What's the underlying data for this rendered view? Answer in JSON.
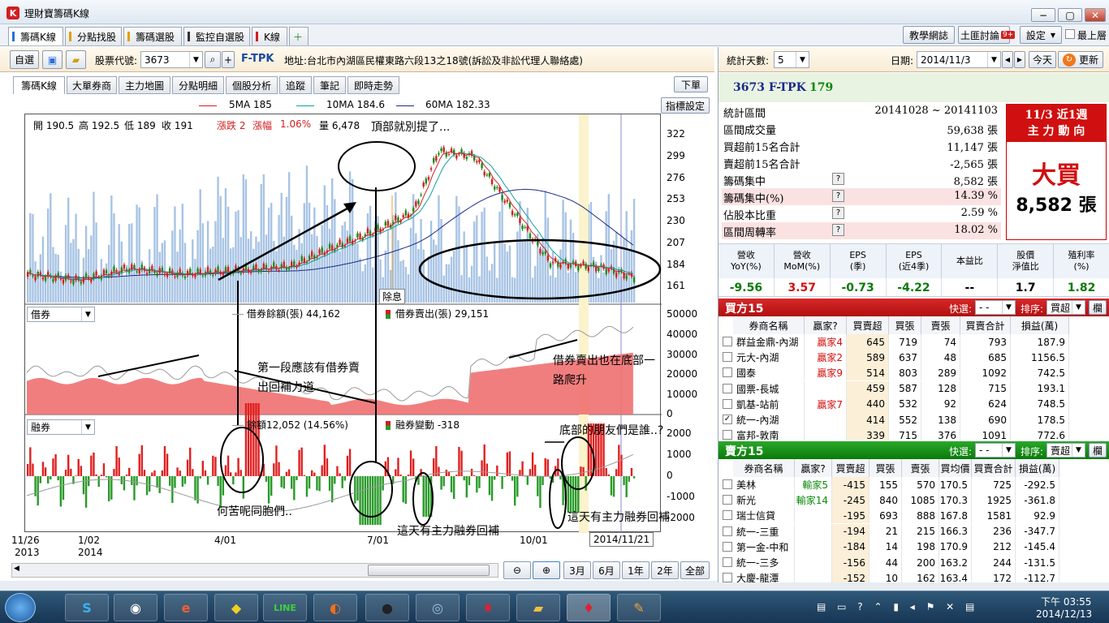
{
  "window": {
    "title": "理財寶籌碼K線",
    "logo": "K"
  },
  "app_tabs": [
    {
      "label": "籌碼K線",
      "color": "#2a6fd6"
    },
    {
      "label": "分點找股",
      "color": "#e0a000"
    },
    {
      "label": "籌碼選股",
      "color": "#e0a000"
    },
    {
      "label": "監控自選股",
      "color": "#333333"
    },
    {
      "label": "K線",
      "color": "#d02020"
    }
  ],
  "top_right": {
    "blog": "教學網誌",
    "forum": "土匪討論",
    "forum_badge": "9+",
    "settings": "設定",
    "topmost": "最上層"
  },
  "toolbar": {
    "watch": "自選",
    "code_label": "股票代號:",
    "code": "3673",
    "stock": "F-TPK",
    "address": "地址:台北市內湖區民權東路六段13之18號(訴訟及非訟代理人聯絡處)"
  },
  "sub_tabs": [
    "籌碼K線",
    "大單券商",
    "主力地圖",
    "分點明細",
    "個股分析",
    "追蹤",
    "筆記",
    "即時走勢"
  ],
  "order_btn": "下單",
  "indicator_btn": "指標設定",
  "legend": {
    "ma5": "5MA 185",
    "ma10": "10MA 184.6",
    "ma60": "60MA 182.33",
    "ma5_color": "#d02020",
    "ma10_color": "#10a0a0",
    "ma60_color": "#1a2a8a"
  },
  "ohlc": {
    "open": "開 190.5",
    "high": "高 192.5",
    "low": "低 189",
    "close": "收 191",
    "chg": "漲跌 2",
    "pct_label": "漲幅",
    "pct": "1.06%",
    "vol": "量 6,478"
  },
  "price_axis": [
    "322",
    "299",
    "276",
    "253",
    "230",
    "207",
    "184",
    "161"
  ],
  "margin_panel": {
    "select": "借券",
    "bal": "借券餘額(張) 44,162",
    "sell": "借券賣出(張) 29,151",
    "axis": [
      "50000",
      "40000",
      "30000",
      "20000",
      "10000",
      "0"
    ]
  },
  "short_panel": {
    "select": "融券",
    "bal": "餘額12,052 (14.56%)",
    "chg": "融券變動 -318",
    "axis": [
      "2000",
      "1000",
      "0",
      "-1000",
      "-2000"
    ]
  },
  "dividend_tag": "除息",
  "x_axis": [
    {
      "t": "11/26",
      "y": "2013"
    },
    {
      "t": "1/02",
      "y": "2014"
    },
    {
      "t": "4/01",
      "y": ""
    },
    {
      "t": "7/01",
      "y": ""
    },
    {
      "t": "10/01",
      "y": ""
    }
  ],
  "cursor_date": "2014/11/21",
  "annotations": {
    "top": "頂部就別提了...",
    "seg1": "第一段應該有借券賣",
    "seg1b": "出回補力道",
    "bottom": "借券賣出也在底部一",
    "bottomb": "路爬升",
    "friends": "底部的朋友們是誰..?",
    "why": "何苦呢同胞們..",
    "cover1": "這天有主力融券回補",
    "cover2": "這天有主力融券回補"
  },
  "zoom_btns": [
    "3月",
    "6月",
    "1年",
    "2年",
    "全部"
  ],
  "right": {
    "days_label": "統計天數:",
    "days": "5",
    "date_label": "日期:",
    "date": "2014/11/3",
    "today": "今天",
    "refresh": "更新",
    "stock": "3673 F-TPK",
    "price": "179",
    "stats": [
      {
        "k": "統計區間",
        "v": "20141028 ~ 20141103",
        "q": false,
        "hl": false
      },
      {
        "k": "區間成交量",
        "v": "59,638 張",
        "q": false,
        "hl": false
      },
      {
        "k": "買超前15名合計",
        "v": "11,147 張",
        "q": false,
        "hl": false
      },
      {
        "k": "賣超前15名合計",
        "v": "-2,565 張",
        "q": false,
        "hl": false
      },
      {
        "k": "籌碼集中",
        "v": "8,582 張",
        "q": true,
        "hl": false
      },
      {
        "k": "籌碼集中(%)",
        "v": "14.39 %",
        "q": true,
        "hl": true
      },
      {
        "k": "佔股本比重",
        "v": "2.59 %",
        "q": true,
        "hl": false
      },
      {
        "k": "區間周轉率",
        "v": "18.02 %",
        "q": true,
        "hl": true
      }
    ],
    "badge_title": "11/3 近1週",
    "badge_sub": "主 力 動 向",
    "badge_big": "大買",
    "badge_val": "8,582 張",
    "metrics": [
      {
        "h": "營收\nYoY(%)",
        "v": "-9.56",
        "c": "#0a7a0a"
      },
      {
        "h": "營收\nMoM(%)",
        "v": "3.57",
        "c": "#d01010"
      },
      {
        "h": "EPS\n(季)",
        "v": "-0.73",
        "c": "#0a7a0a"
      },
      {
        "h": "EPS\n(近4季)",
        "v": "-4.22",
        "c": "#0a7a0a"
      },
      {
        "h": "本益比",
        "v": "--",
        "c": "#000000"
      },
      {
        "h": "股價\n淨值比",
        "v": "1.7",
        "c": "#000000"
      },
      {
        "h": "殖利率\n(%)",
        "v": "1.82",
        "c": "#0a7a0a"
      }
    ],
    "buy": {
      "title": "買方15",
      "quick": "快選:",
      "quick_v": "- -",
      "sort": "排序:",
      "sort_v": "買超",
      "col": "欄",
      "headers": [
        "券商名稱",
        "贏家?",
        "買賣超",
        "買張",
        "賣張",
        "買賣合計",
        "損益(萬)"
      ],
      "rows": [
        [
          "群益金鼎-內湖",
          "贏家4",
          "645",
          "719",
          "74",
          "793",
          "187.9"
        ],
        [
          "元大-內湖",
          "贏家2",
          "589",
          "637",
          "48",
          "685",
          "1156.5"
        ],
        [
          "國泰",
          "贏家9",
          "514",
          "803",
          "289",
          "1092",
          "742.5"
        ],
        [
          "國票-長城",
          "",
          "459",
          "587",
          "128",
          "715",
          "193.1"
        ],
        [
          "凱基-站前",
          "贏家7",
          "440",
          "532",
          "92",
          "624",
          "748.5"
        ],
        [
          "統一-內湖",
          "",
          "414",
          "552",
          "138",
          "690",
          "178.5"
        ],
        [
          "富邦-敦南",
          "",
          "339",
          "715",
          "376",
          "1091",
          "772.6"
        ]
      ]
    },
    "sell": {
      "title": "賣方15",
      "quick": "快選:",
      "quick_v": "- -",
      "sort": "排序:",
      "sort_v": "賣超",
      "col": "欄",
      "headers": [
        "券商名稱",
        "贏家?",
        "買賣超",
        "買張",
        "賣張",
        "買均價",
        "買賣合計",
        "損益(萬)"
      ],
      "rows": [
        [
          "美林",
          "輸家5",
          "-415",
          "155",
          "570",
          "170.5",
          "725",
          "-292.5"
        ],
        [
          "新光",
          "輸家14",
          "-245",
          "840",
          "1085",
          "170.3",
          "1925",
          "-361.8"
        ],
        [
          "瑞士信貸",
          "",
          "-195",
          "693",
          "888",
          "167.8",
          "1581",
          "92.9"
        ],
        [
          "統一-三重",
          "",
          "-194",
          "21",
          "215",
          "166.3",
          "236",
          "-347.7"
        ],
        [
          "第一金-中和",
          "",
          "-184",
          "14",
          "198",
          "170.9",
          "212",
          "-145.4"
        ],
        [
          "統一-三多",
          "",
          "-156",
          "44",
          "200",
          "163.2",
          "244",
          "-131.5"
        ],
        [
          "大慶-龍潭",
          "",
          "-152",
          "10",
          "162",
          "163.4",
          "172",
          "-112.7"
        ]
      ]
    }
  },
  "taskbar": {
    "time": "下午 03:55",
    "date": "2014/12/13"
  }
}
